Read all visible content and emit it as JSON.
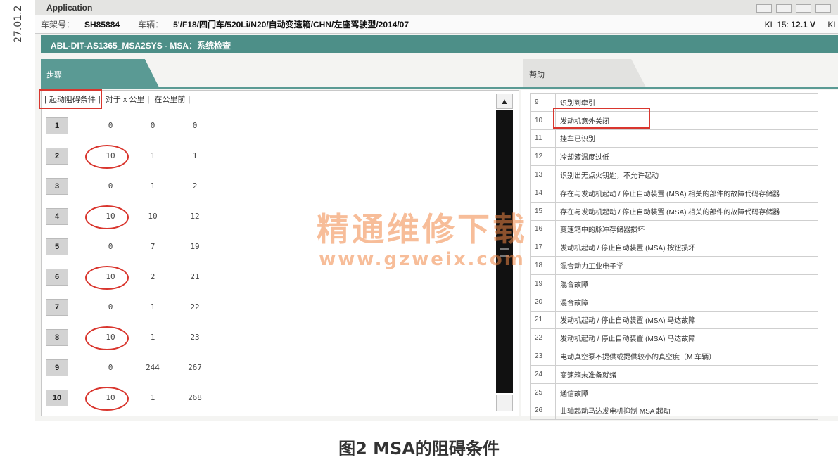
{
  "side_date": "27.01.2",
  "app": {
    "title": "Application"
  },
  "vehicle_bar": {
    "chassis_label": "车架号：",
    "chassis_value": "SH85884",
    "vehicle_label": "车辆：",
    "vehicle_value": "5'/F18/四门车/520Li/N20/自动变速箱/CHN/左座驾驶型/2014/07",
    "kl15_label": "KL 15:",
    "kl15_value": "12.1 V",
    "kl30_label": "KL"
  },
  "module_bar": {
    "text": "ABL-DIT-AS1365_MSA2SYS - MSA：系统检查"
  },
  "tabs": {
    "steps": "步骤",
    "help": "帮助"
  },
  "left_table": {
    "headers": [
      "起动阻碍条件",
      "对于 x 公里",
      "在公里前"
    ],
    "rows": [
      {
        "num": "1",
        "a": "0",
        "b": "0",
        "c": "0",
        "circled": false
      },
      {
        "num": "2",
        "a": "10",
        "b": "1",
        "c": "1",
        "circled": true
      },
      {
        "num": "3",
        "a": "0",
        "b": "1",
        "c": "2",
        "circled": false
      },
      {
        "num": "4",
        "a": "10",
        "b": "10",
        "c": "12",
        "circled": true
      },
      {
        "num": "5",
        "a": "0",
        "b": "7",
        "c": "19",
        "circled": false
      },
      {
        "num": "6",
        "a": "10",
        "b": "2",
        "c": "21",
        "circled": true
      },
      {
        "num": "7",
        "a": "0",
        "b": "1",
        "c": "22",
        "circled": false
      },
      {
        "num": "8",
        "a": "10",
        "b": "1",
        "c": "23",
        "circled": true
      },
      {
        "num": "9",
        "a": "0",
        "b": "244",
        "c": "267",
        "circled": false
      },
      {
        "num": "10",
        "a": "10",
        "b": "1",
        "c": "268",
        "circled": true
      }
    ]
  },
  "help_table": {
    "rows": [
      {
        "num": "9",
        "desc": "识别到牵引"
      },
      {
        "num": "10",
        "desc": "发动机意外关闭"
      },
      {
        "num": "11",
        "desc": "挂车已识别"
      },
      {
        "num": "12",
        "desc": "冷却液温度过低"
      },
      {
        "num": "13",
        "desc": "识别出无点火钥匙，不允许起动"
      },
      {
        "num": "14",
        "desc": "存在与发动机起动 / 停止自动装置 (MSA) 相关的部件的故障代码存储器"
      },
      {
        "num": "15",
        "desc": "存在与发动机起动 / 停止自动装置 (MSA) 相关的部件的故障代码存储器"
      },
      {
        "num": "16",
        "desc": "变速箱中的脉冲存储器损坏"
      },
      {
        "num": "17",
        "desc": "发动机起动 / 停止自动装置 (MSA) 按钮损坏"
      },
      {
        "num": "18",
        "desc": "混合动力工业电子学"
      },
      {
        "num": "19",
        "desc": "混合故障"
      },
      {
        "num": "20",
        "desc": "混合故障"
      },
      {
        "num": "21",
        "desc": "发动机起动 / 停止自动装置 (MSA) 马达故障"
      },
      {
        "num": "22",
        "desc": "发动机起动 / 停止自动装置 (MSA) 马达故障"
      },
      {
        "num": "23",
        "desc": "电动真空泵不提供或提供较小的真空度（M 车辆）"
      },
      {
        "num": "24",
        "desc": "变速箱未准备就绪"
      },
      {
        "num": "25",
        "desc": "通信故障"
      },
      {
        "num": "26",
        "desc": "曲轴起动马达发电机抑制 MSA 起动"
      }
    ]
  },
  "watermark": {
    "line1": "精通维修下载",
    "line2": "www.gzweix.com"
  },
  "caption": "图2 MSA的阻碍条件",
  "colors": {
    "accent": "#4d8f88",
    "highlight": "#d9362e"
  }
}
